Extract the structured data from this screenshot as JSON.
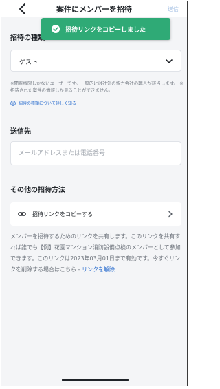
{
  "header": {
    "title": "案件にメンバーを招待",
    "send_label": "送信"
  },
  "toast": {
    "message": "招待リンクをコピーしました"
  },
  "invite_type": {
    "section_label": "招待の種類",
    "selected_value": "ゲスト",
    "note": "※閲覧権限しかないユーザーです。一般的には社外の協力会社の職人が該当します。 ※招待された案件の情報しか見ることができません。",
    "info_link_text": "招待の種類について詳しく知る"
  },
  "recipient": {
    "section_label": "送信先",
    "placeholder": "メールアドレスまたは電話番号"
  },
  "other_methods": {
    "section_label": "その他の招待方法",
    "copy_link_label": "招待リンクをコピーする",
    "description": "メンバーを招待するためのリンクを共有します。このリンクを共有すれば誰でも【例】花園マンション消防設備点検のメンバーとして参加できます。このリンクは2023年03月01日まで有効です。今すぐリンクを削除する場合はこちら - ",
    "revoke_link_text": "リンクを解除"
  },
  "colors": {
    "toast_bg": "#2faa76",
    "link": "#2d6fcf",
    "background": "#f4f5f7"
  },
  "icons": {
    "back": "chevron-left-icon",
    "toast": "check-circle-icon",
    "select": "chevron-down-icon",
    "info": "info-icon",
    "link": "link-icon",
    "row": "chevron-right-icon"
  }
}
